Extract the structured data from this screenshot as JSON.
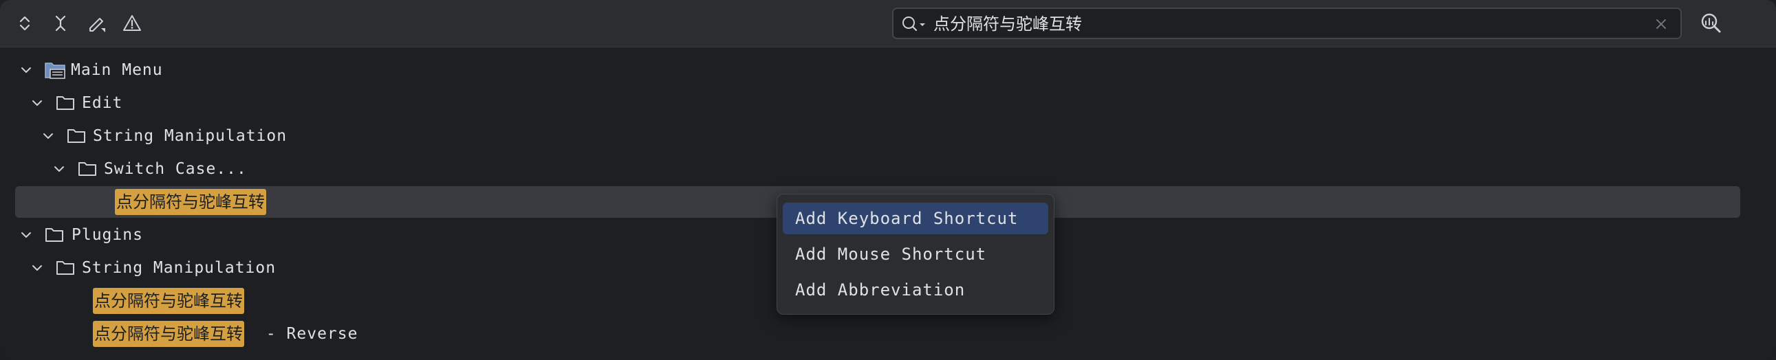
{
  "toolbar": {
    "icons": [
      "expand-collapse-icon",
      "collapse-all-icon",
      "edit-shortcut-icon",
      "warning-icon"
    ],
    "search": {
      "value": "点分隔符与驼峰互转",
      "clear_icon": "close-icon"
    },
    "find_shortcut_icon": "find-by-shortcut-icon"
  },
  "tree": {
    "main_menu": "Main Menu",
    "edit": "Edit",
    "string_manipulation_1": "String Manipulation",
    "switch_case": "Switch Case...",
    "action_match_1": "点分隔符与驼峰互转",
    "plugins": "Plugins",
    "string_manipulation_2": "String Manipulation",
    "action_match_2": "点分隔符与驼峰互转",
    "action_match_3": "点分隔符与驼峰互转",
    "action_match_3_suffix": " - Reverse"
  },
  "context_menu": {
    "items": [
      "Add Keyboard Shortcut",
      "Add Mouse Shortcut",
      "Add Abbreviation"
    ],
    "active_index": 0
  },
  "colors": {
    "background": "#1e1f22",
    "toolbar": "#2b2d30",
    "highlight": "#d4a040",
    "selection": "#393b40",
    "menu_active": "#2e436e"
  }
}
